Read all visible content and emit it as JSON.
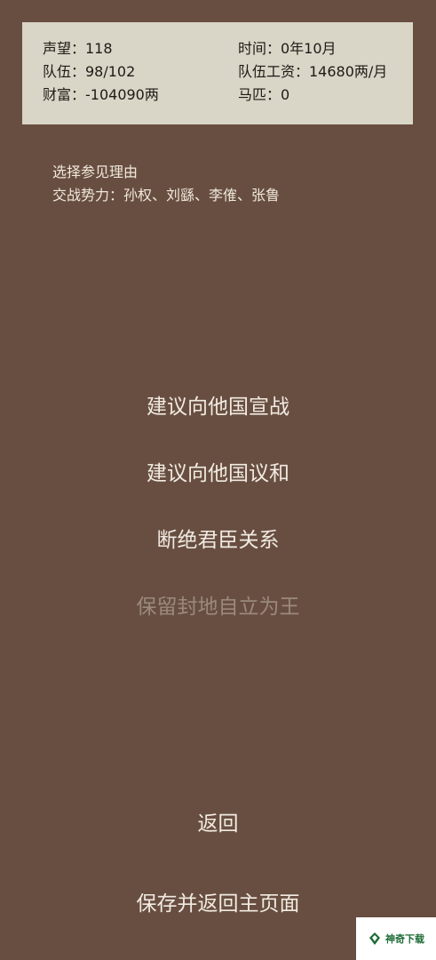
{
  "stats": {
    "reputation": "声望：118",
    "time": "时间：0年10月",
    "troops": "队伍：98/102",
    "troop_wage": "队伍工资：14680两/月",
    "wealth": "财富：-104090两",
    "horses": "马匹：0"
  },
  "reason": {
    "title": "选择参见理由",
    "factions": "交战势力：孙权、刘繇、李傕、张鲁"
  },
  "options": {
    "declare_war": "建议向他国宣战",
    "propose_peace": "建议向他国议和",
    "break_relations": "断绝君臣关系",
    "become_king": "保留封地自立为王"
  },
  "nav": {
    "back": "返回",
    "save_and_return": "保存并返回主页面"
  },
  "watermark": {
    "text": "神奇下载",
    "icon": "leaf-logo-icon",
    "color": "#1d6b35"
  },
  "colors": {
    "background": "#684e41",
    "panel": "#d9d6c7",
    "option_text": "#f1ebe2",
    "disabled_text": "#9a8a7c"
  }
}
